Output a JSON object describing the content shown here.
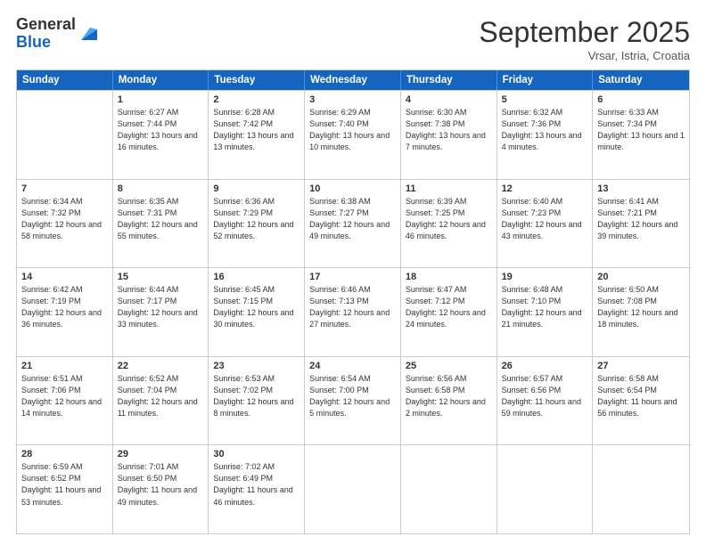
{
  "header": {
    "logo_general": "General",
    "logo_blue": "Blue",
    "month_title": "September 2025",
    "subtitle": "Vrsar, Istria, Croatia"
  },
  "days_of_week": [
    "Sunday",
    "Monday",
    "Tuesday",
    "Wednesday",
    "Thursday",
    "Friday",
    "Saturday"
  ],
  "weeks": [
    [
      {
        "day": "",
        "sunrise": "",
        "sunset": "",
        "daylight": ""
      },
      {
        "day": "1",
        "sunrise": "Sunrise: 6:27 AM",
        "sunset": "Sunset: 7:44 PM",
        "daylight": "Daylight: 13 hours and 16 minutes."
      },
      {
        "day": "2",
        "sunrise": "Sunrise: 6:28 AM",
        "sunset": "Sunset: 7:42 PM",
        "daylight": "Daylight: 13 hours and 13 minutes."
      },
      {
        "day": "3",
        "sunrise": "Sunrise: 6:29 AM",
        "sunset": "Sunset: 7:40 PM",
        "daylight": "Daylight: 13 hours and 10 minutes."
      },
      {
        "day": "4",
        "sunrise": "Sunrise: 6:30 AM",
        "sunset": "Sunset: 7:38 PM",
        "daylight": "Daylight: 13 hours and 7 minutes."
      },
      {
        "day": "5",
        "sunrise": "Sunrise: 6:32 AM",
        "sunset": "Sunset: 7:36 PM",
        "daylight": "Daylight: 13 hours and 4 minutes."
      },
      {
        "day": "6",
        "sunrise": "Sunrise: 6:33 AM",
        "sunset": "Sunset: 7:34 PM",
        "daylight": "Daylight: 13 hours and 1 minute."
      }
    ],
    [
      {
        "day": "7",
        "sunrise": "Sunrise: 6:34 AM",
        "sunset": "Sunset: 7:32 PM",
        "daylight": "Daylight: 12 hours and 58 minutes."
      },
      {
        "day": "8",
        "sunrise": "Sunrise: 6:35 AM",
        "sunset": "Sunset: 7:31 PM",
        "daylight": "Daylight: 12 hours and 55 minutes."
      },
      {
        "day": "9",
        "sunrise": "Sunrise: 6:36 AM",
        "sunset": "Sunset: 7:29 PM",
        "daylight": "Daylight: 12 hours and 52 minutes."
      },
      {
        "day": "10",
        "sunrise": "Sunrise: 6:38 AM",
        "sunset": "Sunset: 7:27 PM",
        "daylight": "Daylight: 12 hours and 49 minutes."
      },
      {
        "day": "11",
        "sunrise": "Sunrise: 6:39 AM",
        "sunset": "Sunset: 7:25 PM",
        "daylight": "Daylight: 12 hours and 46 minutes."
      },
      {
        "day": "12",
        "sunrise": "Sunrise: 6:40 AM",
        "sunset": "Sunset: 7:23 PM",
        "daylight": "Daylight: 12 hours and 43 minutes."
      },
      {
        "day": "13",
        "sunrise": "Sunrise: 6:41 AM",
        "sunset": "Sunset: 7:21 PM",
        "daylight": "Daylight: 12 hours and 39 minutes."
      }
    ],
    [
      {
        "day": "14",
        "sunrise": "Sunrise: 6:42 AM",
        "sunset": "Sunset: 7:19 PM",
        "daylight": "Daylight: 12 hours and 36 minutes."
      },
      {
        "day": "15",
        "sunrise": "Sunrise: 6:44 AM",
        "sunset": "Sunset: 7:17 PM",
        "daylight": "Daylight: 12 hours and 33 minutes."
      },
      {
        "day": "16",
        "sunrise": "Sunrise: 6:45 AM",
        "sunset": "Sunset: 7:15 PM",
        "daylight": "Daylight: 12 hours and 30 minutes."
      },
      {
        "day": "17",
        "sunrise": "Sunrise: 6:46 AM",
        "sunset": "Sunset: 7:13 PM",
        "daylight": "Daylight: 12 hours and 27 minutes."
      },
      {
        "day": "18",
        "sunrise": "Sunrise: 6:47 AM",
        "sunset": "Sunset: 7:12 PM",
        "daylight": "Daylight: 12 hours and 24 minutes."
      },
      {
        "day": "19",
        "sunrise": "Sunrise: 6:48 AM",
        "sunset": "Sunset: 7:10 PM",
        "daylight": "Daylight: 12 hours and 21 minutes."
      },
      {
        "day": "20",
        "sunrise": "Sunrise: 6:50 AM",
        "sunset": "Sunset: 7:08 PM",
        "daylight": "Daylight: 12 hours and 18 minutes."
      }
    ],
    [
      {
        "day": "21",
        "sunrise": "Sunrise: 6:51 AM",
        "sunset": "Sunset: 7:06 PM",
        "daylight": "Daylight: 12 hours and 14 minutes."
      },
      {
        "day": "22",
        "sunrise": "Sunrise: 6:52 AM",
        "sunset": "Sunset: 7:04 PM",
        "daylight": "Daylight: 12 hours and 11 minutes."
      },
      {
        "day": "23",
        "sunrise": "Sunrise: 6:53 AM",
        "sunset": "Sunset: 7:02 PM",
        "daylight": "Daylight: 12 hours and 8 minutes."
      },
      {
        "day": "24",
        "sunrise": "Sunrise: 6:54 AM",
        "sunset": "Sunset: 7:00 PM",
        "daylight": "Daylight: 12 hours and 5 minutes."
      },
      {
        "day": "25",
        "sunrise": "Sunrise: 6:56 AM",
        "sunset": "Sunset: 6:58 PM",
        "daylight": "Daylight: 12 hours and 2 minutes."
      },
      {
        "day": "26",
        "sunrise": "Sunrise: 6:57 AM",
        "sunset": "Sunset: 6:56 PM",
        "daylight": "Daylight: 11 hours and 59 minutes."
      },
      {
        "day": "27",
        "sunrise": "Sunrise: 6:58 AM",
        "sunset": "Sunset: 6:54 PM",
        "daylight": "Daylight: 11 hours and 56 minutes."
      }
    ],
    [
      {
        "day": "28",
        "sunrise": "Sunrise: 6:59 AM",
        "sunset": "Sunset: 6:52 PM",
        "daylight": "Daylight: 11 hours and 53 minutes."
      },
      {
        "day": "29",
        "sunrise": "Sunrise: 7:01 AM",
        "sunset": "Sunset: 6:50 PM",
        "daylight": "Daylight: 11 hours and 49 minutes."
      },
      {
        "day": "30",
        "sunrise": "Sunrise: 7:02 AM",
        "sunset": "Sunset: 6:49 PM",
        "daylight": "Daylight: 11 hours and 46 minutes."
      },
      {
        "day": "",
        "sunrise": "",
        "sunset": "",
        "daylight": ""
      },
      {
        "day": "",
        "sunrise": "",
        "sunset": "",
        "daylight": ""
      },
      {
        "day": "",
        "sunrise": "",
        "sunset": "",
        "daylight": ""
      },
      {
        "day": "",
        "sunrise": "",
        "sunset": "",
        "daylight": ""
      }
    ]
  ]
}
